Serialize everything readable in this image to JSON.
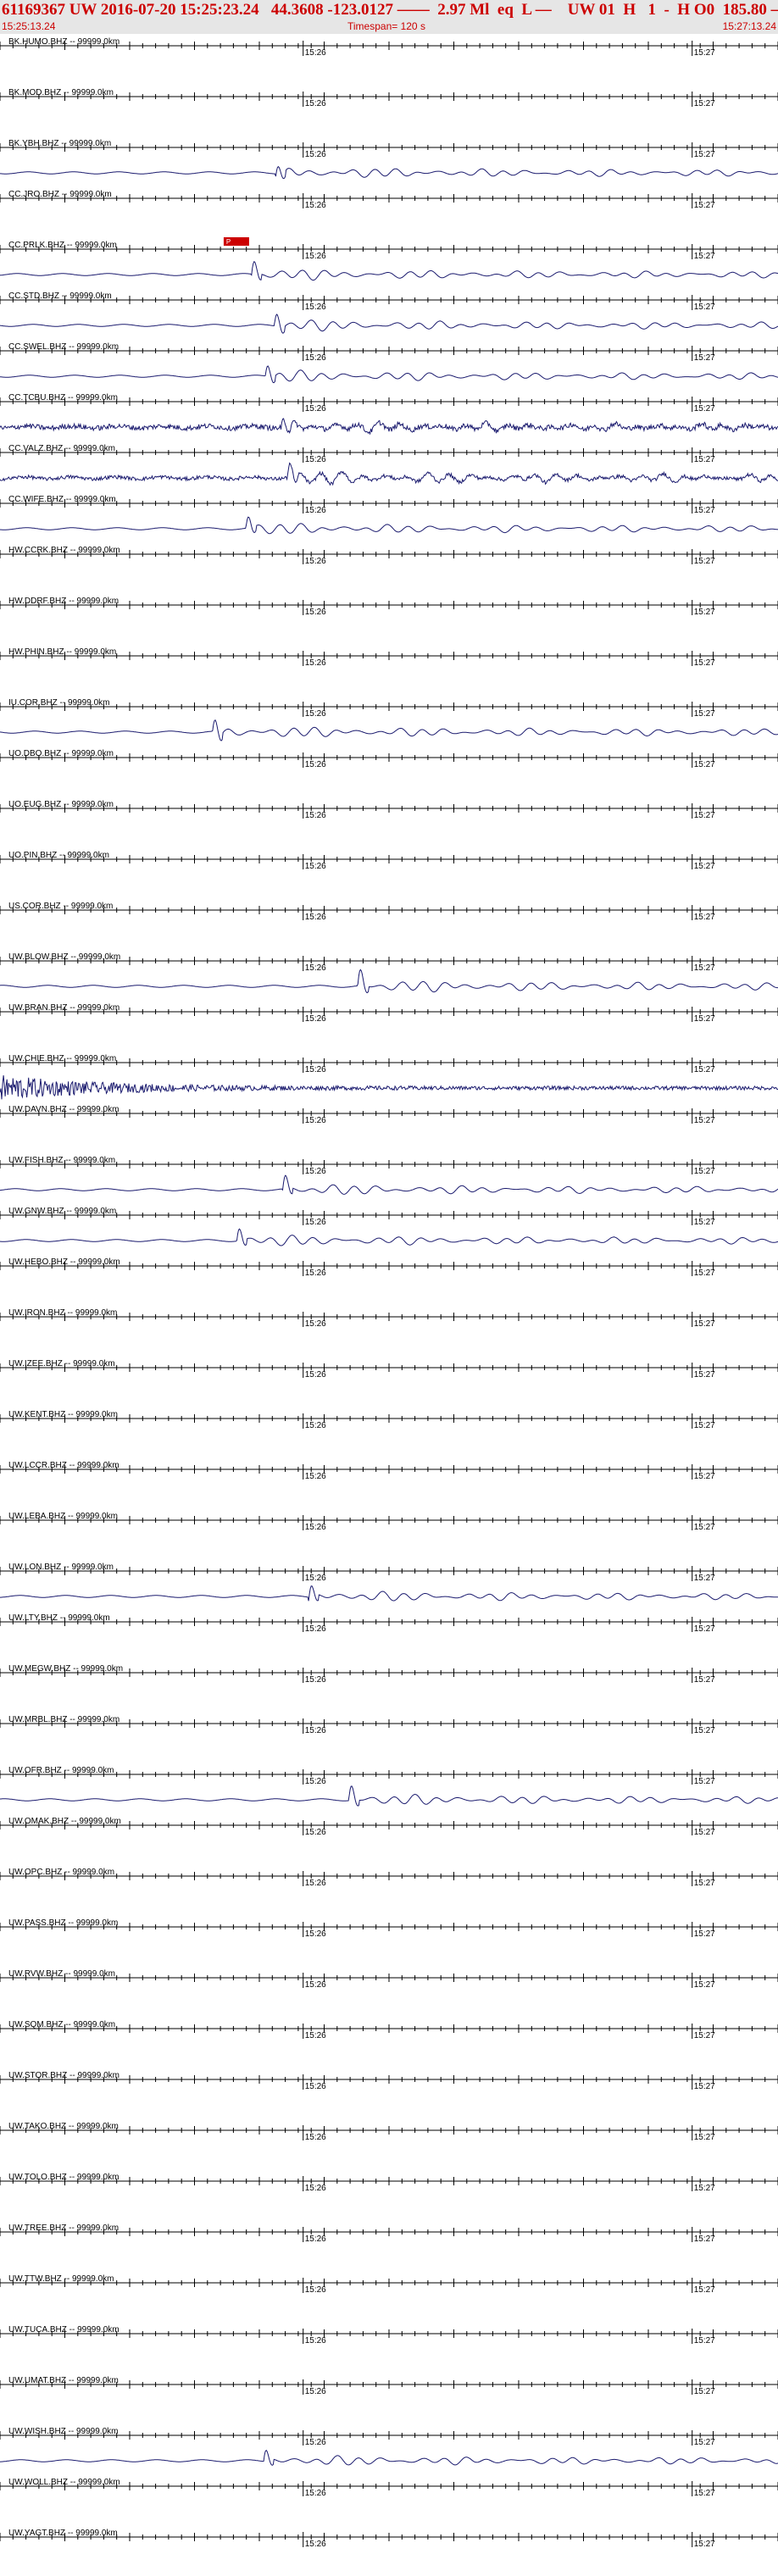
{
  "header": {
    "title": "61169367 UW 2016-07-20 15:25:23.24   44.3608 -123.0127 ——  2.97 Ml  eq  L —    UW 01  H   1  -  H O0  185.80 ——",
    "start_time": "15:25:13.24",
    "timespan": "Timespan= 120 s",
    "end_time": "15:27:13.24"
  },
  "chart_data": {
    "type": "line",
    "x_unit": "s",
    "xlim": [
      0,
      120
    ],
    "time_marks": [
      {
        "label": "15:26",
        "t": 46.76
      },
      {
        "label": "15:27",
        "t": 106.76
      }
    ],
    "pick_label": "P",
    "pick_time": 34.5,
    "traces": [
      {
        "label": "BK.HUMO.BHZ -- 99999.0km",
        "active": false
      },
      {
        "label": "BK.MOD.BHZ -- 99999.0km",
        "active": false
      },
      {
        "label": "BK.YBH.BHZ -- 99999.0km",
        "active": true,
        "onset": 42.5,
        "amp": 1.0
      },
      {
        "label": "CC.JRO.BHZ -- 99999.0km",
        "active": false
      },
      {
        "label": "CC.PRLK.BHZ -- 99999.0km",
        "active": true,
        "onset": 38.8,
        "amp": 1.0
      },
      {
        "label": "CC.STD.BHZ -- 99999.0km",
        "active": true,
        "onset": 42.3,
        "amp": 1.0
      },
      {
        "label": "CC.SWEL.BHZ -- 99999.0km",
        "active": true,
        "onset": 40.9,
        "amp": 1.0
      },
      {
        "label": "CC.TCBU.BHZ -- 99999.0km",
        "active": true,
        "onset": 43.3,
        "amp": 1.0,
        "noise": 0.6
      },
      {
        "label": "CC.VALZ.BHZ -- 99999.0km",
        "active": true,
        "onset": 44.3,
        "amp": 1.2,
        "noise": 0.35
      },
      {
        "label": "CC.WIFE.BHZ -- 99999.0km",
        "active": true,
        "onset": 37.9,
        "amp": 1.0
      },
      {
        "label": "HW.CCRK.BHZ -- 99999.0km",
        "active": false
      },
      {
        "label": "HW.DDRF.BHZ -- 99999.0km",
        "active": false
      },
      {
        "label": "HW.PHIN.BHZ -- 99999.0km",
        "active": false
      },
      {
        "label": "IU.COR.BHZ -- 99999.0km",
        "active": true,
        "onset": 32.8,
        "amp": 1.1
      },
      {
        "label": "UO.DBO.BHZ -- 99999.0km",
        "active": false
      },
      {
        "label": "UO.EUG.BHZ -- 99999.0km",
        "active": false
      },
      {
        "label": "UO.PIN.BHZ -- 99999.0km",
        "active": false
      },
      {
        "label": "US.COR.BHZ -- 99999.0km",
        "active": false
      },
      {
        "label": "UW.BLOW.BHZ -- 99999.0km",
        "active": true,
        "onset": 55.2,
        "amp": 1.1
      },
      {
        "label": "UW.BRAN.BHZ -- 99999.0km",
        "active": false
      },
      {
        "label": "UW.CHIE.BHZ -- 99999.0km",
        "active": true,
        "onset": 0.5,
        "amp": 1.0,
        "burst": true
      },
      {
        "label": "UW.DAVN.BHZ -- 99999.0km",
        "active": false
      },
      {
        "label": "UW.FISH.BHZ -- 99999.0km",
        "active": true,
        "onset": 43.6,
        "amp": 1.0
      },
      {
        "label": "UW.GNW.BHZ -- 99999.0km",
        "active": true,
        "onset": 36.5,
        "amp": 1.0
      },
      {
        "label": "UW.HEBO.BHZ -- 99999.0km",
        "active": false
      },
      {
        "label": "UW.IRON.BHZ -- 99999.0km",
        "active": false
      },
      {
        "label": "UW.IZEE.BHZ -- 99999.0km",
        "active": false
      },
      {
        "label": "UW.KENT.BHZ -- 99999.0km",
        "active": false
      },
      {
        "label": "UW.LCCR.BHZ -- 99999.0km",
        "active": false
      },
      {
        "label": "UW.LEBA.BHZ -- 99999.0km",
        "active": false
      },
      {
        "label": "UW.LON.BHZ -- 99999.0km",
        "active": true,
        "onset": 47.6,
        "amp": 1.0
      },
      {
        "label": "UW.LTY.BHZ -- 99999.0km",
        "active": false
      },
      {
        "label": "UW.MEGW.BHZ -- 99999.0km",
        "active": false
      },
      {
        "label": "UW.MRBL.BHZ -- 99999.0km",
        "active": false
      },
      {
        "label": "UW.OFR.BHZ -- 99999.0km",
        "active": true,
        "onset": 53.8,
        "amp": 1.0
      },
      {
        "label": "UW.OMAK.BHZ -- 99999.0km",
        "active": false
      },
      {
        "label": "UW.OPC.BHZ -- 99999.0km",
        "active": false
      },
      {
        "label": "UW.PASS.BHZ -- 99999.0km",
        "active": false
      },
      {
        "label": "UW.RVW.BHZ -- 99999.0km",
        "active": false
      },
      {
        "label": "UW.SQM.BHZ -- 99999.0km",
        "active": false
      },
      {
        "label": "UW.STOR.BHZ -- 99999.0km",
        "active": false
      },
      {
        "label": "UW.TAKO.BHZ -- 99999.0km",
        "active": false
      },
      {
        "label": "UW.TOLO.BHZ -- 99999.0km",
        "active": false
      },
      {
        "label": "UW.TREE.BHZ -- 99999.0km",
        "active": false
      },
      {
        "label": "UW.TTW.BHZ -- 99999.0km",
        "active": false
      },
      {
        "label": "UW.TUCA.BHZ -- 99999.0km",
        "active": false
      },
      {
        "label": "UW.UMAT.BHZ -- 99999.0km",
        "active": false
      },
      {
        "label": "UW.WISH.BHZ -- 99999.0km",
        "active": true,
        "onset": 40.6,
        "amp": 1.0
      },
      {
        "label": "UW.WOLL.BHZ -- 99999.0km",
        "active": false
      },
      {
        "label": "UW.YAGT.BHZ -- 99999.0km",
        "active": false
      }
    ],
    "colors": {
      "header_bg": "#e6e6e6",
      "header_text": "#cc0000",
      "trace": "#1a1a6e",
      "axis": "#000000",
      "pick": "#cc0000"
    }
  }
}
